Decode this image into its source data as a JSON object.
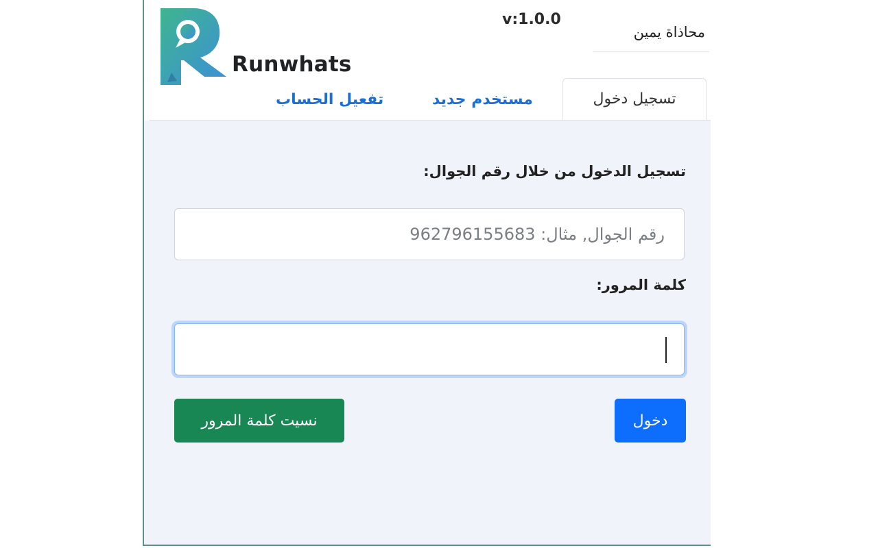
{
  "header": {
    "brand": "Runwhats",
    "version": "v:1.0.0",
    "align_label": "محاذاة يمين"
  },
  "tabs": [
    {
      "label": "تسجيل دخول",
      "active": true
    },
    {
      "label": "مستخدم جديد",
      "active": false
    },
    {
      "label": "تفعيل الحساب",
      "active": false
    }
  ],
  "login": {
    "phone_label": "تسجيل الدخول من خلال رقم الجوال:",
    "phone_placeholder": "رقم الجوال, مثال: 962796155683",
    "phone_value": "",
    "password_label": "كلمة المرور:",
    "password_value": "",
    "login_button": "دخول",
    "forgot_button": "نسيت كلمة المرور"
  },
  "colors": {
    "primary": "#0d6efd",
    "success": "#198754",
    "tab_link": "#1a6fd6",
    "panel_bg": "#f0f3f9",
    "logo_green": "#3fb58f",
    "logo_blue": "#3b8fd9"
  },
  "icons": [
    "runwhats-logo-icon"
  ]
}
